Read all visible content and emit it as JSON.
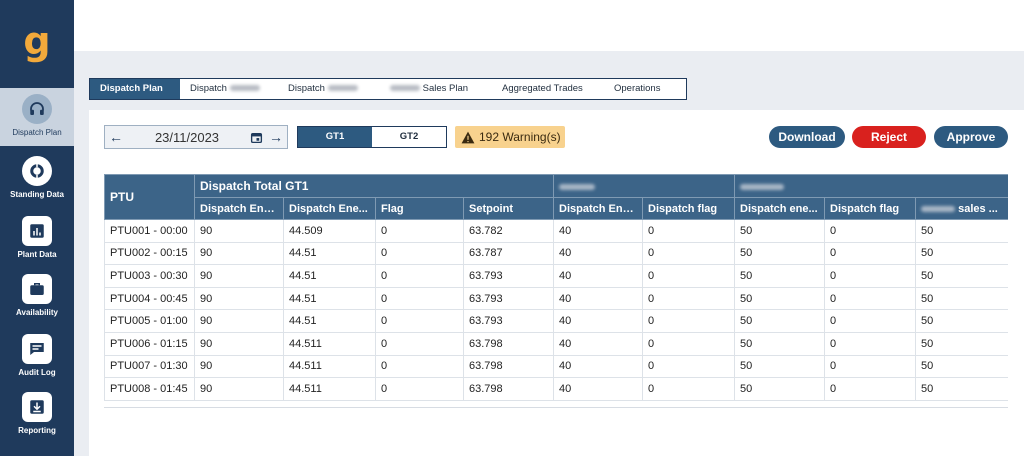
{
  "brand": {
    "logo_letter": "g",
    "logo_color": "#f2a93b",
    "sidebar_color": "#1f3a5c",
    "accent": "#2d5a80",
    "danger": "#d9211e",
    "warning_bg": "#f8d28e"
  },
  "sidebar": {
    "items": [
      {
        "label": "Dispatch Plan",
        "icon": "headset-icon",
        "active": true
      },
      {
        "label": "Standing Data",
        "icon": "ring-icon",
        "active": false
      },
      {
        "label": "Plant Data",
        "icon": "bar-chart-icon",
        "active": false
      },
      {
        "label": "Availability",
        "icon": "briefcase-icon",
        "active": false
      },
      {
        "label": "Audit Log",
        "icon": "chat-bubble-icon",
        "active": false
      },
      {
        "label": "Reporting",
        "icon": "download-icon",
        "active": false
      }
    ]
  },
  "tabs": [
    {
      "label": "Dispatch Plan",
      "active": true
    },
    {
      "label": "Dispatch",
      "redacted_suffix": true
    },
    {
      "label": "Dispatch",
      "redacted_suffix": true
    },
    {
      "label": "Sales Plan",
      "redacted_prefix": true
    },
    {
      "label": "Aggregated Trades"
    },
    {
      "label": "Operations"
    }
  ],
  "toolbar": {
    "date": "23/11/2023",
    "gt_options": [
      "GT1",
      "GT2"
    ],
    "gt_selected": "GT1",
    "warning_text": "192 Warning(s)",
    "download_label": "Download",
    "reject_label": "Reject",
    "approve_label": "Approve"
  },
  "table": {
    "group_headers": {
      "ptu": "PTU",
      "dispatch_total": "Dispatch Total GT1"
    },
    "columns": [
      "Dispatch Ene...",
      "Dispatch Ene...",
      "Flag",
      "Setpoint",
      "Dispatch Ene...",
      "Dispatch flag",
      "Dispatch ene...",
      "Dispatch flag",
      "sales ..."
    ],
    "rows": [
      [
        "PTU001 - 00:00",
        "90",
        "44.509",
        "0",
        "63.782",
        "40",
        "0",
        "50",
        "0",
        "50"
      ],
      [
        "PTU002 - 00:15",
        "90",
        "44.51",
        "0",
        "63.787",
        "40",
        "0",
        "50",
        "0",
        "50"
      ],
      [
        "PTU003 - 00:30",
        "90",
        "44.51",
        "0",
        "63.793",
        "40",
        "0",
        "50",
        "0",
        "50"
      ],
      [
        "PTU004 - 00:45",
        "90",
        "44.51",
        "0",
        "63.793",
        "40",
        "0",
        "50",
        "0",
        "50"
      ],
      [
        "PTU005 - 01:00",
        "90",
        "44.51",
        "0",
        "63.793",
        "40",
        "0",
        "50",
        "0",
        "50"
      ],
      [
        "PTU006 - 01:15",
        "90",
        "44.511",
        "0",
        "63.798",
        "40",
        "0",
        "50",
        "0",
        "50"
      ],
      [
        "PTU007 - 01:30",
        "90",
        "44.511",
        "0",
        "63.798",
        "40",
        "0",
        "50",
        "0",
        "50"
      ],
      [
        "PTU008 - 01:45",
        "90",
        "44.511",
        "0",
        "63.798",
        "40",
        "0",
        "50",
        "0",
        "50"
      ]
    ]
  }
}
